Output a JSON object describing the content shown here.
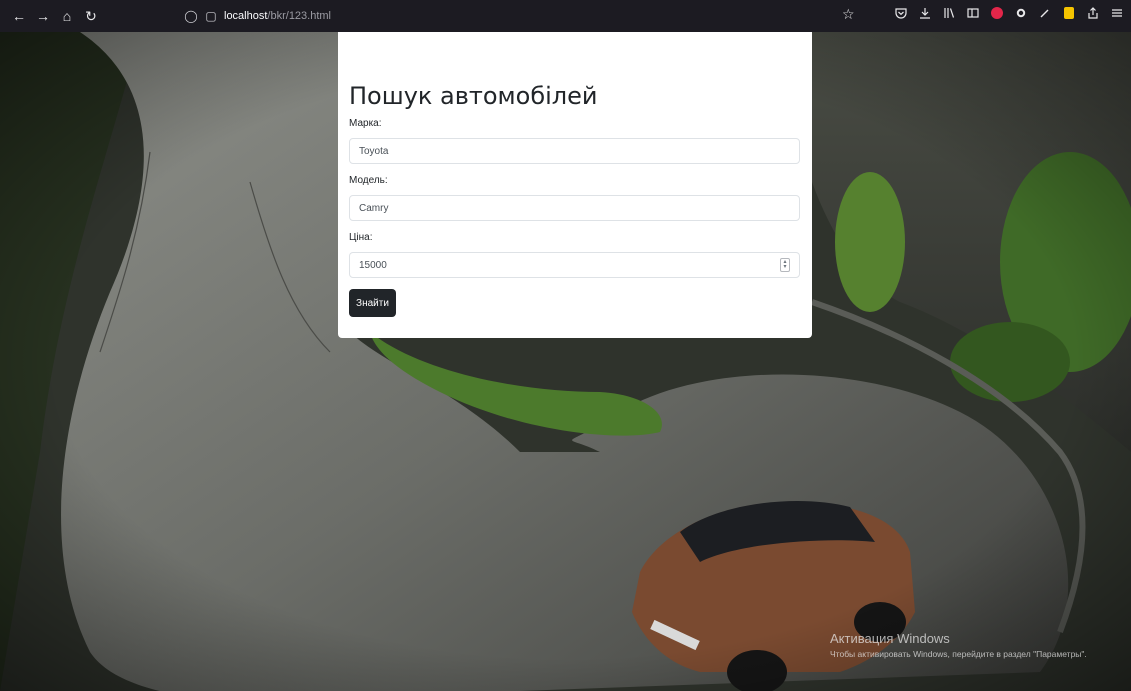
{
  "browser": {
    "url_host": "localhost",
    "url_path": "/bkr/123.html",
    "back_icon": "←",
    "forward_icon": "→",
    "home_icon": "⌂",
    "reload_icon": "↻",
    "shield_icon": "◯",
    "page_icon": "▢",
    "bookmark_icon": "☆"
  },
  "form": {
    "title": "Пошук автомобілей",
    "make_label": "Марка:",
    "make_value": "Toyota",
    "model_label": "Модель:",
    "model_value": "Camry",
    "price_label": "Ціна:",
    "price_value": "15000",
    "submit_label": "Знайти"
  },
  "watermark": {
    "title": "Активация Windows",
    "subtitle": "Чтобы активировать Windows, перейдите в раздел \"Параметры\"."
  },
  "colors": {
    "chrome_bg": "#1c1b22",
    "button_bg": "#212529",
    "card_bg": "#ffffff"
  }
}
